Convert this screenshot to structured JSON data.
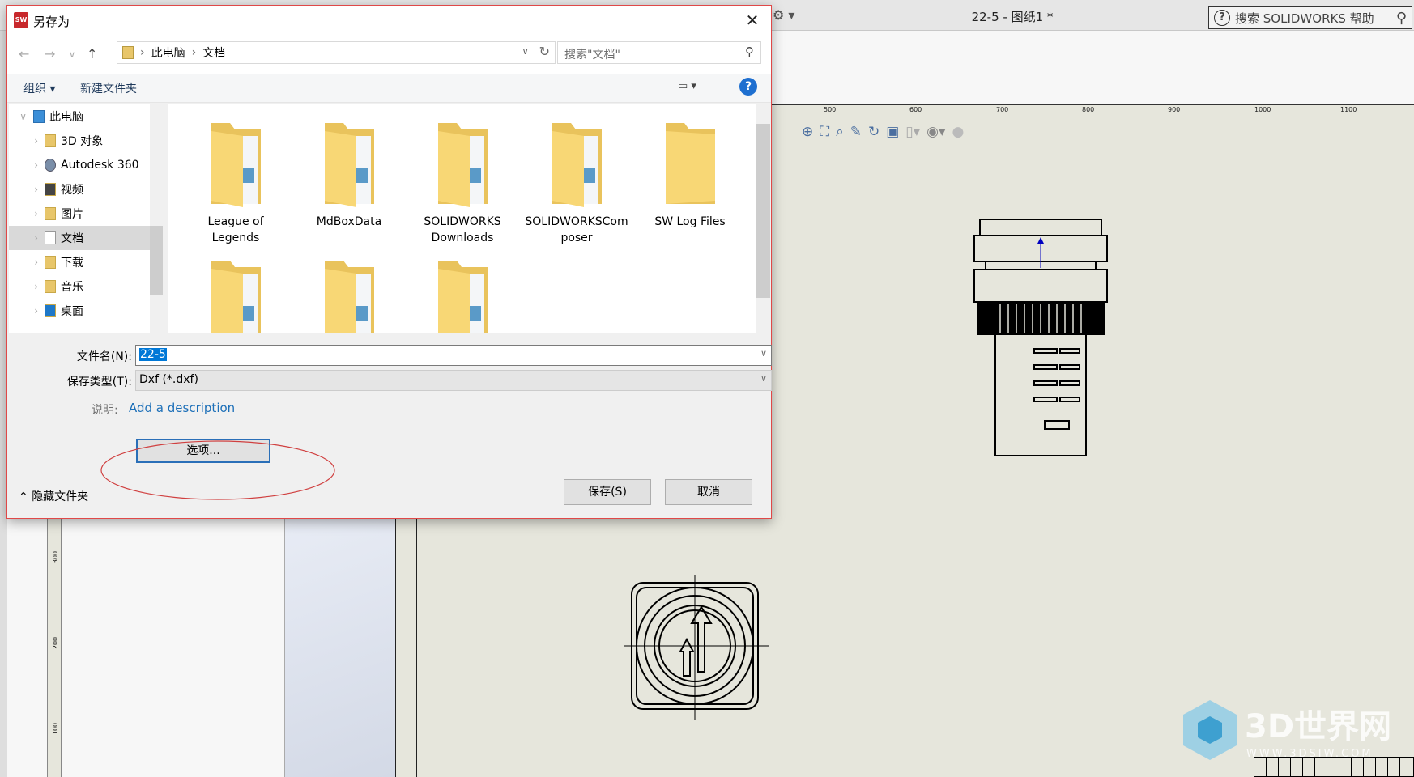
{
  "solidworks": {
    "title": "22-5 - 图纸1 *",
    "search_placeholder": "搜索 SOLIDWORKS 帮助",
    "ruler_h": [
      "500",
      "600",
      "700",
      "800",
      "900",
      "1000",
      "1100"
    ],
    "ruler_v": [
      "300",
      "200",
      "100"
    ],
    "watermark": "3D世界网",
    "watermark_url": "WWW.3DSJW.COM",
    "sheet_color": "#e6e6dc"
  },
  "dialog": {
    "title": "另存为",
    "close": "✕",
    "breadcrumb": [
      "此电脑",
      "文档"
    ],
    "search_placeholder": "搜索\"文档\"",
    "toolbar": {
      "organize": "组织 ▾",
      "new_folder": "新建文件夹",
      "help": "?"
    },
    "nav": [
      {
        "label": "此电脑",
        "expanded": true
      },
      {
        "label": "3D 对象"
      },
      {
        "label": "Autodesk 360"
      },
      {
        "label": "视频"
      },
      {
        "label": "图片"
      },
      {
        "label": "文档",
        "selected": true
      },
      {
        "label": "下载"
      },
      {
        "label": "音乐"
      },
      {
        "label": "桌面"
      }
    ],
    "folders": [
      {
        "name": "League of Legends"
      },
      {
        "name": "MdBoxData"
      },
      {
        "name": "SOLIDWORKS Downloads"
      },
      {
        "name": "SOLIDWORKSComposer"
      },
      {
        "name": "SW Log Files"
      },
      {
        "name": ""
      },
      {
        "name": ""
      },
      {
        "name": ""
      }
    ],
    "filename_label": "文件名(N):",
    "filename_value": "22-5",
    "filetype_label": "保存类型(T):",
    "filetype_value": "Dxf (*.dxf)",
    "description_label": "说明:",
    "description_link": "Add a description",
    "options_button": "选项...",
    "hide_folders": "隐藏文件夹",
    "save_button": "保存(S)",
    "cancel_button": "取消",
    "accent": "#0078d7",
    "annotation_color": "#d04040"
  }
}
